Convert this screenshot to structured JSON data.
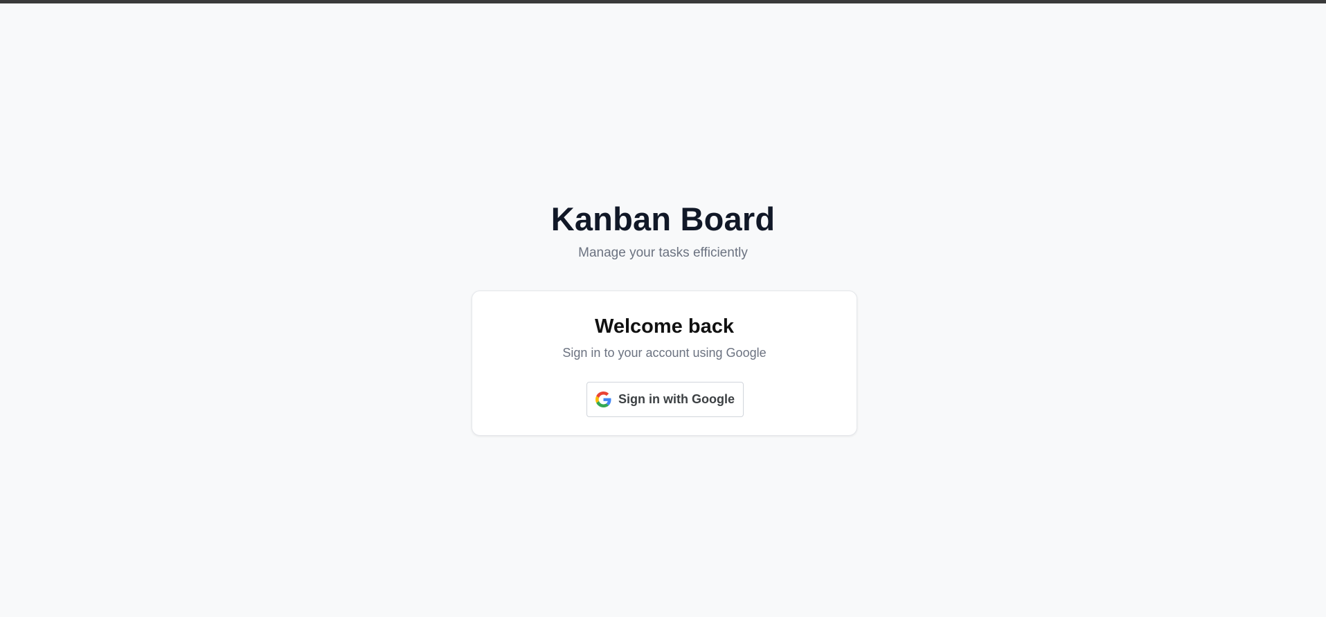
{
  "app": {
    "title": "Kanban Board",
    "subtitle": "Manage your tasks efficiently"
  },
  "login_card": {
    "title": "Welcome back",
    "subtitle": "Sign in to your account using Google",
    "google_button": {
      "label": "Sign in with Google",
      "icon": "google-icon"
    }
  },
  "colors": {
    "background": "#f8f9fa",
    "title": "#111827",
    "muted_text": "#6b7280",
    "card_border": "#e5e7eb",
    "button_border": "#d1d5db",
    "google_blue": "#4285F4",
    "google_green": "#34A853",
    "google_yellow": "#FBBC05",
    "google_red": "#EA4335"
  }
}
